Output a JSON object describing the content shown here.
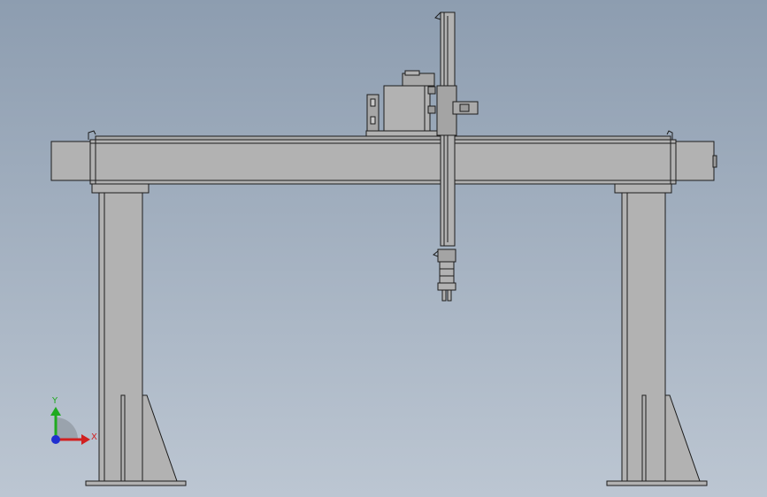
{
  "viewport": {
    "background_top": "#8d9db0",
    "background_bottom": "#bcc6d2",
    "part_fill": "#b2b2b2",
    "part_shade": "#a4a4a4",
    "edge_color": "#1c1c1c"
  },
  "triad": {
    "x_label": "X",
    "y_label": "Y",
    "x_color": "#d12020",
    "y_color": "#1faa1f",
    "z_color": "#1f2fd0"
  }
}
